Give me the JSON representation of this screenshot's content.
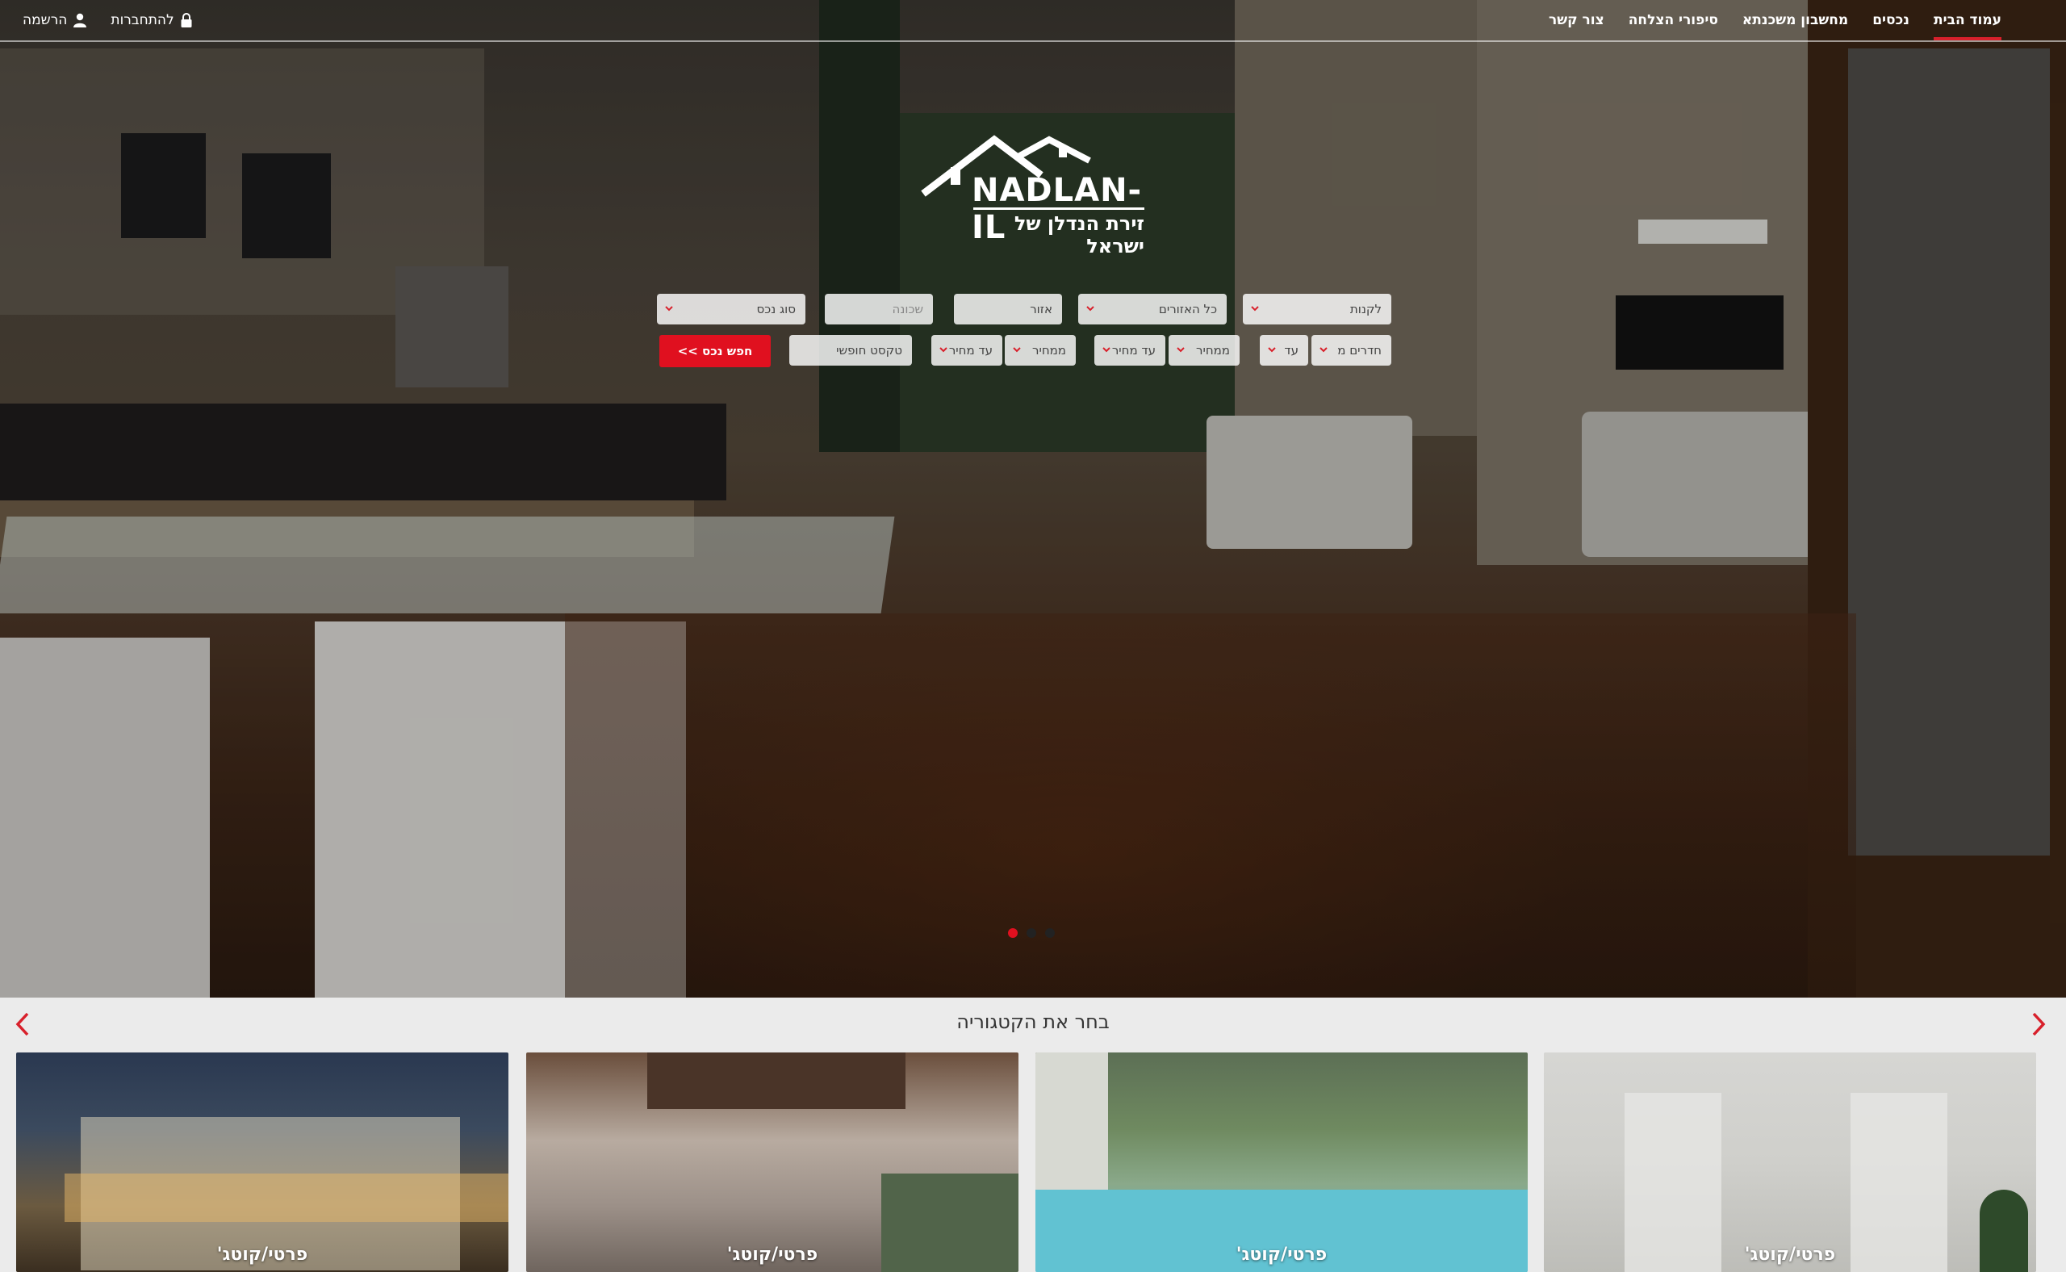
{
  "nav": {
    "items": [
      {
        "label": "עמוד הבית",
        "active": true
      },
      {
        "label": "נכסים",
        "active": false
      },
      {
        "label": "מחשבון משכנתא",
        "active": false
      },
      {
        "label": "סיפורי הצלחה",
        "active": false
      },
      {
        "label": "צור קשר",
        "active": false
      }
    ],
    "login_label": "להתחברות",
    "register_label": "הרשמה"
  },
  "logo": {
    "brand": "NADLAN-IL",
    "tagline": "זירת הנדלן של ישראל"
  },
  "search": {
    "deal_type": "לקנות",
    "all_regions": "כל האזורים",
    "area_placeholder": "אזור",
    "neighborhood_placeholder": "שכונה",
    "property_type": "סוג נכס",
    "rooms_from": "חדרים מ",
    "rooms_to": "עד",
    "price_from_1": "ממחיר",
    "price_to_1": "עד מחיר",
    "price_from_2": "ממחיר",
    "price_to_2": "עד מחיר",
    "free_text_placeholder": "טקסט חופשי",
    "search_button": "חפש נכס >>"
  },
  "slider": {
    "slides": 3,
    "active_index": 0
  },
  "categories": {
    "title": "בחר את הקטגוריה",
    "cards": [
      {
        "label": "פרטי/קוטג'"
      },
      {
        "label": "פרטי/קוטג'"
      },
      {
        "label": "פרטי/קוטג'"
      },
      {
        "label": "פרטי/קוטג'"
      }
    ]
  },
  "colors": {
    "accent": "#e0101f",
    "background": "#ebebeb"
  }
}
